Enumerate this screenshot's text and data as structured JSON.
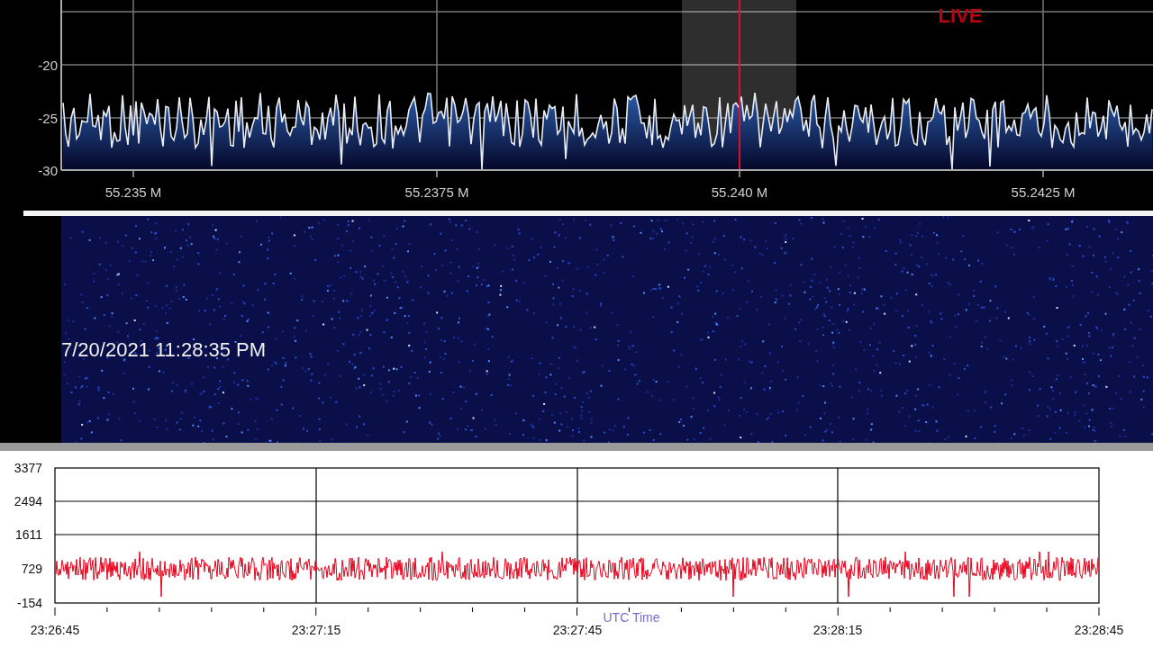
{
  "spectrum": {
    "live_label": "LIVE",
    "y_labels": [
      "-20",
      "-25",
      "-30"
    ],
    "x_labels": [
      "55.235 M",
      "55.2375 M",
      "55.240 M",
      "55.2425 M"
    ]
  },
  "waterfall": {
    "timestamp": "7/20/2021 11:28:35 PM"
  },
  "timeline": {
    "y_labels": [
      "3377",
      "2494",
      "1611",
      "729",
      "-154"
    ],
    "x_labels": [
      "23:26:45",
      "23:27:15",
      "23:27:45",
      "23:28:15",
      "23:28:45"
    ],
    "axis_title": "UTC Time"
  }
}
